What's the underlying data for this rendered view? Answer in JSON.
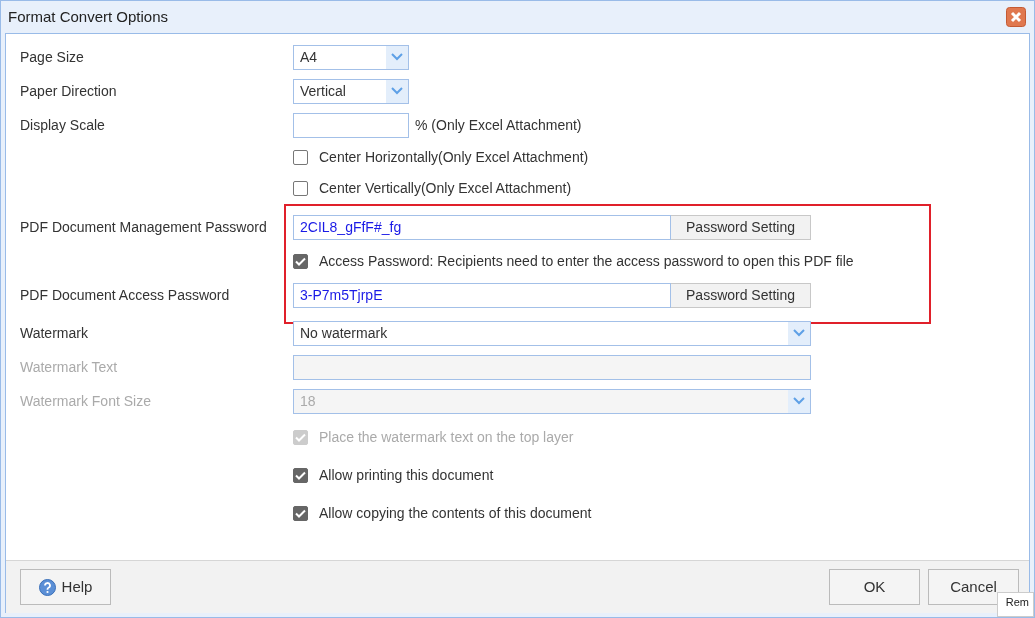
{
  "window": {
    "title": "Format Convert Options"
  },
  "rows": [
    {
      "kind": "picker",
      "label": "Page Size",
      "value": "A4",
      "disabled": false
    },
    {
      "kind": "picker",
      "label": "Paper Direction",
      "value": "Vertical",
      "disabled": false
    },
    {
      "kind": "scale",
      "label": "Display Scale",
      "suffix": "% (Only Excel Attachment)"
    },
    {
      "kind": "checkbox",
      "label": "Center Horizontally(Only Excel Attachment)",
      "checked": false,
      "disabled": false
    },
    {
      "kind": "checkbox",
      "label": "Center Vertically(Only Excel Attachment)",
      "checked": false,
      "disabled": false
    },
    {
      "kind": "group",
      "highlighted": true,
      "rows": [
        {
          "kind": "password",
          "label": "PDF Document Management Password",
          "value": "2CIL8_gFfF#_fg",
          "button": "Password Setting"
        },
        {
          "kind": "checkbox",
          "label": "Access Password: Recipients need to enter the access password to open this PDF file",
          "checked": true,
          "disabled": false
        },
        {
          "kind": "password",
          "label": "PDF Document Access Password",
          "value": "3-P7m5TjrpE",
          "button": "Password Setting"
        }
      ]
    },
    {
      "kind": "select",
      "label": "Watermark",
      "value": "No watermark",
      "disabled": false
    },
    {
      "kind": "text",
      "label": "Watermark Text",
      "disabled": true
    },
    {
      "kind": "select",
      "label": "Watermark Font Size",
      "value": "18",
      "disabled": true
    },
    {
      "kind": "checkbox",
      "label": "Place the watermark text on the top layer",
      "checked": true,
      "disabled": true
    },
    {
      "kind": "checkbox",
      "label": "Allow printing this document",
      "checked": true,
      "disabled": false
    },
    {
      "kind": "checkbox",
      "label": "Allow copying the contents of this document",
      "checked": true,
      "disabled": false
    }
  ],
  "footer": {
    "help": "Help",
    "buttons": [
      "OK",
      "Cancel"
    ]
  },
  "tooltip": "Rem"
}
